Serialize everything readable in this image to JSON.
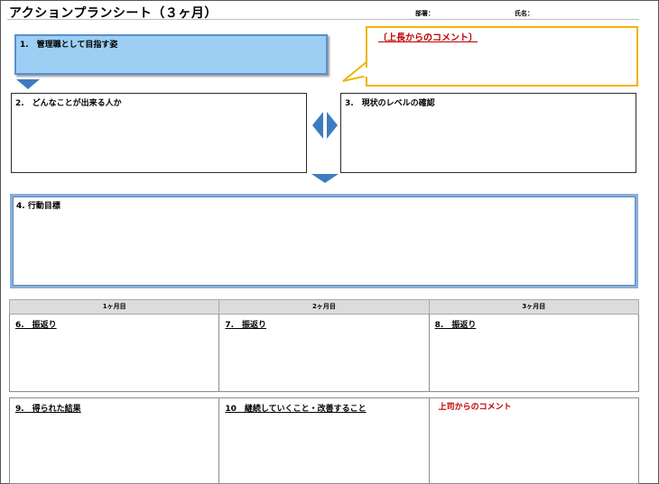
{
  "header": {
    "title": "アクションプランシート（３ヶ月）",
    "department_label": "部署：",
    "name_label": "氏名："
  },
  "sections": {
    "s1": "1.　管理職として目指す姿",
    "s2": "2.　どんなことが出来る人か",
    "s3": "3.　現状のレベルの確認",
    "s4": "4. 行動目標"
  },
  "callout": {
    "text": "〔上長からのコメント〕"
  },
  "review_table": {
    "months": [
      "1ヶ月目",
      "2ヶ月目",
      "3ヶ月目"
    ],
    "review_row": [
      "6.　振返り",
      "7.　振返り",
      "8.　振返り"
    ],
    "result_row": [
      "9.　得られた結果",
      "10　継続していくこと・改善すること",
      "上司からのコメント"
    ]
  },
  "colors": {
    "box1_fill": "#9dcff5",
    "arrow_blue": "#3d7cc2",
    "callout_border": "#f0b400",
    "comment_red": "#c00000"
  },
  "icons": {
    "down_arrow": "triangle-down",
    "left_right_arrows": "triangle-left-right"
  }
}
